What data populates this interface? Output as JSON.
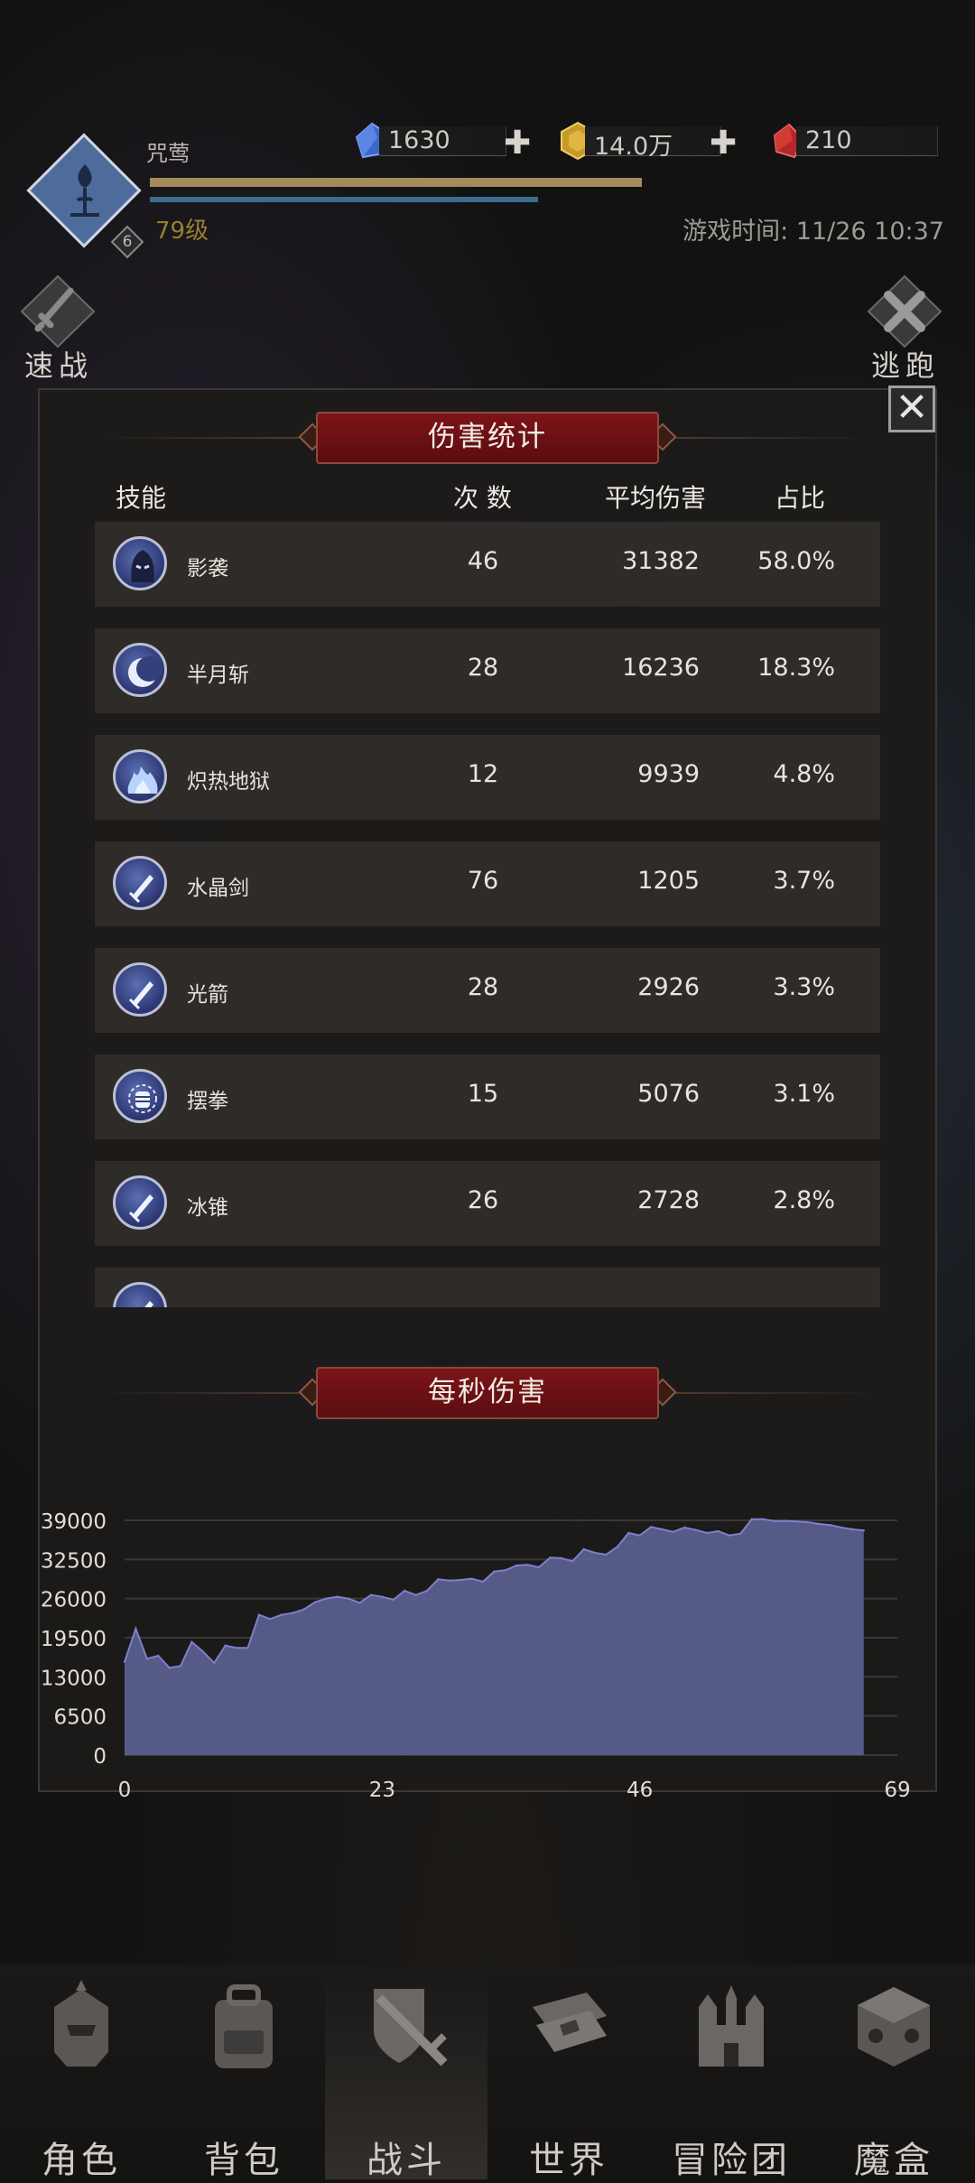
{
  "header": {
    "player_name": "咒莺",
    "level": "79级",
    "rank_badge": "6",
    "currencies": [
      {
        "icon": "blue-gem-icon",
        "value": "1630",
        "has_plus": true
      },
      {
        "icon": "gold-coin-icon",
        "value": "14.0万",
        "has_plus": true
      },
      {
        "icon": "red-gem-icon",
        "value": "210",
        "has_plus": false
      }
    ],
    "game_time": "游戏时间: 11/26 10:37",
    "quick_battle_label": "速战",
    "escape_label": "逃跑"
  },
  "damage_stats": {
    "title": "伤害统计",
    "columns": {
      "skill": "技能",
      "count": "次 数",
      "avg": "平均伤害",
      "share": "占比"
    },
    "rows": [
      {
        "icon": "shadow-hood-icon",
        "name": "影袭",
        "count": "46",
        "avg": "31382",
        "share": "58.0%"
      },
      {
        "icon": "crescent-moon-icon",
        "name": "半月斩",
        "count": "28",
        "avg": "16236",
        "share": "18.3%"
      },
      {
        "icon": "flame-icon",
        "name": "炽热地狱",
        "count": "12",
        "avg": "9939",
        "share": "4.8%"
      },
      {
        "icon": "sword-icon",
        "name": "水晶剑",
        "count": "76",
        "avg": "1205",
        "share": "3.7%"
      },
      {
        "icon": "sword-icon",
        "name": "光箭",
        "count": "28",
        "avg": "2926",
        "share": "3.3%"
      },
      {
        "icon": "fist-icon",
        "name": "摆拳",
        "count": "15",
        "avg": "5076",
        "share": "3.1%"
      },
      {
        "icon": "sword-icon",
        "name": "冰锥",
        "count": "26",
        "avg": "2728",
        "share": "2.8%"
      },
      {
        "icon": "sword-icon",
        "name": "",
        "count": "",
        "avg": "",
        "share": ""
      }
    ]
  },
  "dps": {
    "title": "每秒伤害"
  },
  "chart_data": {
    "type": "area",
    "title": "每秒伤害",
    "xlabel": "",
    "ylabel": "",
    "x_ticks": [
      0,
      23,
      46,
      69
    ],
    "y_ticks": [
      0,
      6500,
      13000,
      19500,
      26000,
      32500,
      39000
    ],
    "xlim": [
      0,
      69
    ],
    "ylim": [
      0,
      39000
    ],
    "grid": true,
    "fill_color": "#5b5f8f",
    "line_color": "#7d80c8",
    "x": [
      0,
      1,
      2,
      3,
      4,
      5,
      6,
      7,
      8,
      9,
      10,
      11,
      12,
      13,
      14,
      15,
      16,
      17,
      18,
      19,
      20,
      21,
      22,
      23,
      24,
      25,
      26,
      27,
      28,
      29,
      30,
      31,
      32,
      33,
      34,
      35,
      36,
      37,
      38,
      39,
      40,
      41,
      42,
      43,
      44,
      45,
      46,
      47,
      48,
      49,
      50,
      51,
      52,
      53,
      54,
      55,
      56,
      57,
      58,
      59,
      60,
      61,
      62,
      63,
      64,
      65,
      66
    ],
    "values": [
      15500,
      21000,
      16000,
      16500,
      14500,
      14800,
      18800,
      17200,
      15300,
      18200,
      17800,
      17800,
      23300,
      22600,
      23300,
      23600,
      24200,
      25400,
      26000,
      26300,
      26000,
      25300,
      26600,
      26300,
      25800,
      27300,
      26600,
      27300,
      29200,
      29000,
      29100,
      29300,
      28800,
      30500,
      30700,
      31500,
      31600,
      31200,
      32800,
      32700,
      32200,
      34200,
      33600,
      33300,
      34600,
      36900,
      36500,
      37900,
      37500,
      37100,
      37800,
      37400,
      36900,
      37200,
      36500,
      36800,
      39200,
      39200,
      38900,
      38900,
      38800,
      38700,
      38400,
      38200,
      37800,
      37500,
      37300
    ]
  },
  "bottom_nav": [
    {
      "icon": "helmet-icon",
      "label": "角色",
      "active": false
    },
    {
      "icon": "backpack-icon",
      "label": "背包",
      "active": false
    },
    {
      "icon": "shield-sword-icon",
      "label": "战斗",
      "active": true
    },
    {
      "icon": "map-scroll-icon",
      "label": "世界",
      "active": false
    },
    {
      "icon": "castle-icon",
      "label": "冒险团",
      "active": false
    },
    {
      "icon": "cube-icon",
      "label": "魔盒",
      "active": false
    }
  ]
}
